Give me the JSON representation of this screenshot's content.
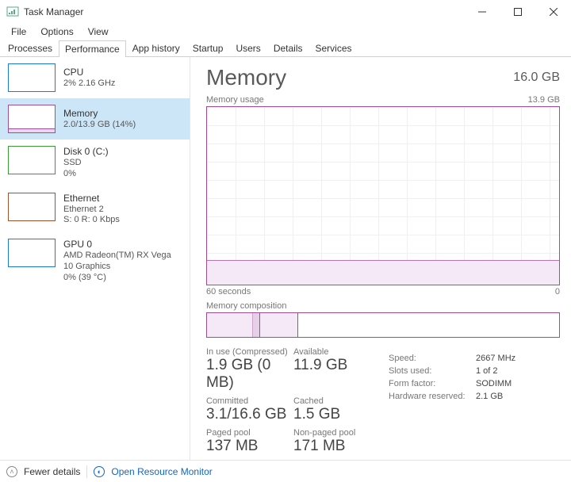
{
  "window": {
    "title": "Task Manager"
  },
  "menus": {
    "file": "File",
    "options": "Options",
    "view": "View"
  },
  "tabs": {
    "processes": "Processes",
    "performance": "Performance",
    "app_history": "App history",
    "startup": "Startup",
    "users": "Users",
    "details": "Details",
    "services": "Services"
  },
  "sidebar": {
    "cpu": {
      "name": "CPU",
      "sub": "2% 2.16 GHz"
    },
    "mem": {
      "name": "Memory",
      "sub": "2.0/13.9 GB (14%)"
    },
    "disk": {
      "name": "Disk 0 (C:)",
      "sub1": "SSD",
      "sub2": "0%"
    },
    "eth": {
      "name": "Ethernet",
      "sub1": "Ethernet 2",
      "sub2": "S: 0 R: 0 Kbps"
    },
    "gpu": {
      "name": "GPU 0",
      "sub1": "AMD Radeon(TM) RX Vega 10 Graphics",
      "sub2": "0% (39 °C)"
    }
  },
  "detail": {
    "title": "Memory",
    "capacity": "16.0 GB",
    "chart_title": "Memory usage",
    "chart_max": "13.9 GB",
    "axis_left": "60 seconds",
    "axis_right": "0",
    "comp_title": "Memory composition",
    "stats": {
      "in_use_l": "In use (Compressed)",
      "in_use_v": "1.9 GB (0 MB)",
      "avail_l": "Available",
      "avail_v": "11.9 GB",
      "commit_l": "Committed",
      "commit_v": "3.1/16.6 GB",
      "cached_l": "Cached",
      "cached_v": "1.5 GB",
      "paged_l": "Paged pool",
      "paged_v": "137 MB",
      "npaged_l": "Non-paged pool",
      "npaged_v": "171 MB"
    },
    "info": {
      "speed_l": "Speed:",
      "speed_v": "2667 MHz",
      "slots_l": "Slots used:",
      "slots_v": "1 of 2",
      "form_l": "Form factor:",
      "form_v": "SODIMM",
      "hw_l": "Hardware reserved:",
      "hw_v": "2.1 GB"
    }
  },
  "footer": {
    "fewer": "Fewer details",
    "resmon": "Open Resource Monitor"
  },
  "chart_data": {
    "type": "area",
    "title": "Memory usage",
    "ylabel": "GB",
    "ylim": [
      0,
      13.9
    ],
    "x_seconds_ago": [
      60,
      55,
      50,
      45,
      40,
      35,
      30,
      25,
      20,
      15,
      10,
      5,
      0
    ],
    "series": [
      {
        "name": "In use",
        "values_gb": [
          2.0,
          2.0,
          2.0,
          2.0,
          2.0,
          2.0,
          2.0,
          2.0,
          2.0,
          2.0,
          2.0,
          2.0,
          2.0
        ]
      }
    ]
  }
}
